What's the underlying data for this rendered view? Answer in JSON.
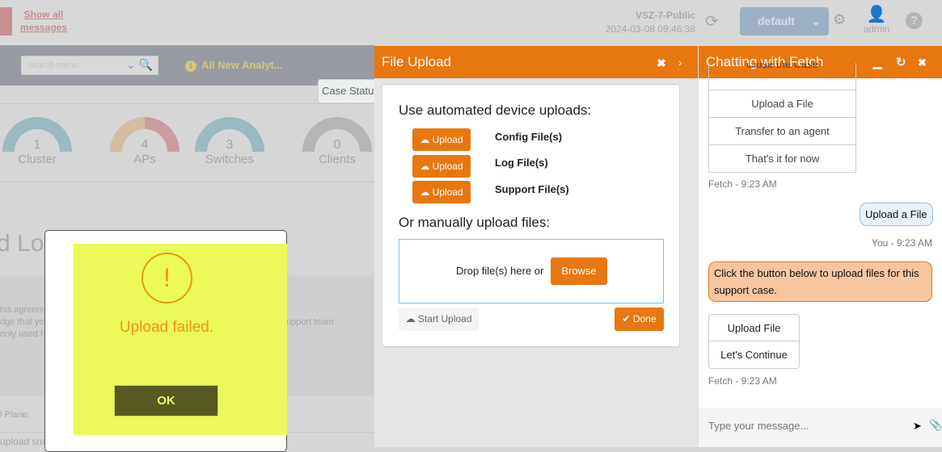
{
  "topbar": {
    "show_all": "Show all messages",
    "system_name": "VSZ-7-Public",
    "datetime": "2024-03-08  09:46:38",
    "domain_select": "default",
    "user": "admin"
  },
  "nav": {
    "search_placeholder": "search menu",
    "announcement": "All New Analyt...",
    "case_status": "Case Status"
  },
  "gauges": [
    {
      "value": "1",
      "label": "Cluster"
    },
    {
      "value": "4",
      "label": "APs"
    },
    {
      "value": "3",
      "label": "Switches"
    },
    {
      "value": "0",
      "label": "Clients"
    }
  ],
  "background": {
    "heading": "d Lo",
    "text1": "his agreeme",
    "text2": "dge that you",
    "text3": " only used f",
    "text4": "upport team",
    "row1": "l Plane:",
    "row2": "upload sna"
  },
  "alert": {
    "message": "Upload failed.",
    "ok": "OK",
    "color": "#ebf95a"
  },
  "file_upload": {
    "title": "File Upload",
    "auto_heading": "Use automated device uploads:",
    "upload_label": "Upload",
    "files": [
      "Config File(s)",
      "Log File(s)",
      "Support File(s)"
    ],
    "manual_heading": "Or manually upload files:",
    "drop_text": "Drop file(s) here or",
    "browse": "Browse",
    "start_upload": "Start Upload",
    "done": "Done",
    "accent": "#e8770f"
  },
  "chat": {
    "title": "Chatting with Fetch",
    "options": [
      "Close the Case",
      "Upload a File",
      "Transfer to an agent",
      "That's it for now"
    ],
    "meta1": "Fetch - 9:23 AM",
    "user_msg": "Upload a File",
    "meta2": "You - 9:23 AM",
    "bot_msg": "Click the button below to upload files for this support case.",
    "buttons": [
      "Upload File",
      "Let's Continue"
    ],
    "meta3": "Fetch - 9:23 AM",
    "input_placeholder": "Type your message..."
  }
}
